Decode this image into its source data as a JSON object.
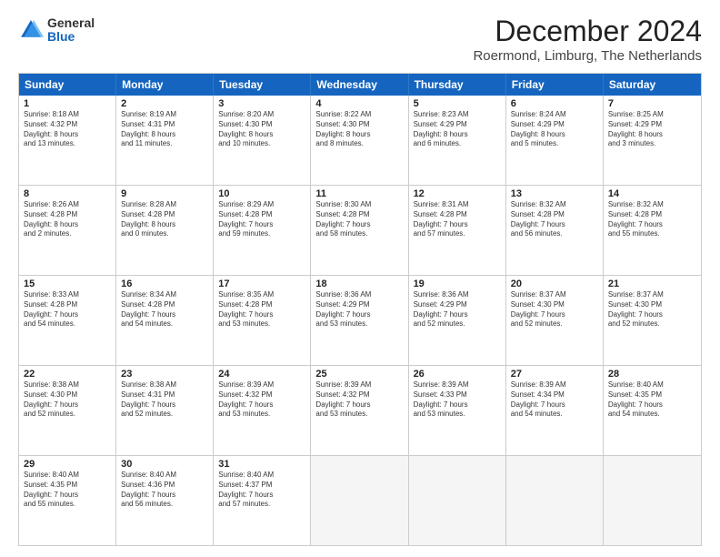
{
  "logo": {
    "general": "General",
    "blue": "Blue"
  },
  "header": {
    "month": "December 2024",
    "location": "Roermond, Limburg, The Netherlands"
  },
  "weekdays": [
    "Sunday",
    "Monday",
    "Tuesday",
    "Wednesday",
    "Thursday",
    "Friday",
    "Saturday"
  ],
  "rows": [
    [
      {
        "day": "1",
        "text": "Sunrise: 8:18 AM\nSunset: 4:32 PM\nDaylight: 8 hours\nand 13 minutes."
      },
      {
        "day": "2",
        "text": "Sunrise: 8:19 AM\nSunset: 4:31 PM\nDaylight: 8 hours\nand 11 minutes."
      },
      {
        "day": "3",
        "text": "Sunrise: 8:20 AM\nSunset: 4:30 PM\nDaylight: 8 hours\nand 10 minutes."
      },
      {
        "day": "4",
        "text": "Sunrise: 8:22 AM\nSunset: 4:30 PM\nDaylight: 8 hours\nand 8 minutes."
      },
      {
        "day": "5",
        "text": "Sunrise: 8:23 AM\nSunset: 4:29 PM\nDaylight: 8 hours\nand 6 minutes."
      },
      {
        "day": "6",
        "text": "Sunrise: 8:24 AM\nSunset: 4:29 PM\nDaylight: 8 hours\nand 5 minutes."
      },
      {
        "day": "7",
        "text": "Sunrise: 8:25 AM\nSunset: 4:29 PM\nDaylight: 8 hours\nand 3 minutes."
      }
    ],
    [
      {
        "day": "8",
        "text": "Sunrise: 8:26 AM\nSunset: 4:28 PM\nDaylight: 8 hours\nand 2 minutes."
      },
      {
        "day": "9",
        "text": "Sunrise: 8:28 AM\nSunset: 4:28 PM\nDaylight: 8 hours\nand 0 minutes."
      },
      {
        "day": "10",
        "text": "Sunrise: 8:29 AM\nSunset: 4:28 PM\nDaylight: 7 hours\nand 59 minutes."
      },
      {
        "day": "11",
        "text": "Sunrise: 8:30 AM\nSunset: 4:28 PM\nDaylight: 7 hours\nand 58 minutes."
      },
      {
        "day": "12",
        "text": "Sunrise: 8:31 AM\nSunset: 4:28 PM\nDaylight: 7 hours\nand 57 minutes."
      },
      {
        "day": "13",
        "text": "Sunrise: 8:32 AM\nSunset: 4:28 PM\nDaylight: 7 hours\nand 56 minutes."
      },
      {
        "day": "14",
        "text": "Sunrise: 8:32 AM\nSunset: 4:28 PM\nDaylight: 7 hours\nand 55 minutes."
      }
    ],
    [
      {
        "day": "15",
        "text": "Sunrise: 8:33 AM\nSunset: 4:28 PM\nDaylight: 7 hours\nand 54 minutes."
      },
      {
        "day": "16",
        "text": "Sunrise: 8:34 AM\nSunset: 4:28 PM\nDaylight: 7 hours\nand 54 minutes."
      },
      {
        "day": "17",
        "text": "Sunrise: 8:35 AM\nSunset: 4:28 PM\nDaylight: 7 hours\nand 53 minutes."
      },
      {
        "day": "18",
        "text": "Sunrise: 8:36 AM\nSunset: 4:29 PM\nDaylight: 7 hours\nand 53 minutes."
      },
      {
        "day": "19",
        "text": "Sunrise: 8:36 AM\nSunset: 4:29 PM\nDaylight: 7 hours\nand 52 minutes."
      },
      {
        "day": "20",
        "text": "Sunrise: 8:37 AM\nSunset: 4:30 PM\nDaylight: 7 hours\nand 52 minutes."
      },
      {
        "day": "21",
        "text": "Sunrise: 8:37 AM\nSunset: 4:30 PM\nDaylight: 7 hours\nand 52 minutes."
      }
    ],
    [
      {
        "day": "22",
        "text": "Sunrise: 8:38 AM\nSunset: 4:30 PM\nDaylight: 7 hours\nand 52 minutes."
      },
      {
        "day": "23",
        "text": "Sunrise: 8:38 AM\nSunset: 4:31 PM\nDaylight: 7 hours\nand 52 minutes."
      },
      {
        "day": "24",
        "text": "Sunrise: 8:39 AM\nSunset: 4:32 PM\nDaylight: 7 hours\nand 53 minutes."
      },
      {
        "day": "25",
        "text": "Sunrise: 8:39 AM\nSunset: 4:32 PM\nDaylight: 7 hours\nand 53 minutes."
      },
      {
        "day": "26",
        "text": "Sunrise: 8:39 AM\nSunset: 4:33 PM\nDaylight: 7 hours\nand 53 minutes."
      },
      {
        "day": "27",
        "text": "Sunrise: 8:39 AM\nSunset: 4:34 PM\nDaylight: 7 hours\nand 54 minutes."
      },
      {
        "day": "28",
        "text": "Sunrise: 8:40 AM\nSunset: 4:35 PM\nDaylight: 7 hours\nand 54 minutes."
      }
    ],
    [
      {
        "day": "29",
        "text": "Sunrise: 8:40 AM\nSunset: 4:35 PM\nDaylight: 7 hours\nand 55 minutes."
      },
      {
        "day": "30",
        "text": "Sunrise: 8:40 AM\nSunset: 4:36 PM\nDaylight: 7 hours\nand 56 minutes."
      },
      {
        "day": "31",
        "text": "Sunrise: 8:40 AM\nSunset: 4:37 PM\nDaylight: 7 hours\nand 57 minutes."
      },
      {
        "day": "",
        "text": ""
      },
      {
        "day": "",
        "text": ""
      },
      {
        "day": "",
        "text": ""
      },
      {
        "day": "",
        "text": ""
      }
    ]
  ]
}
